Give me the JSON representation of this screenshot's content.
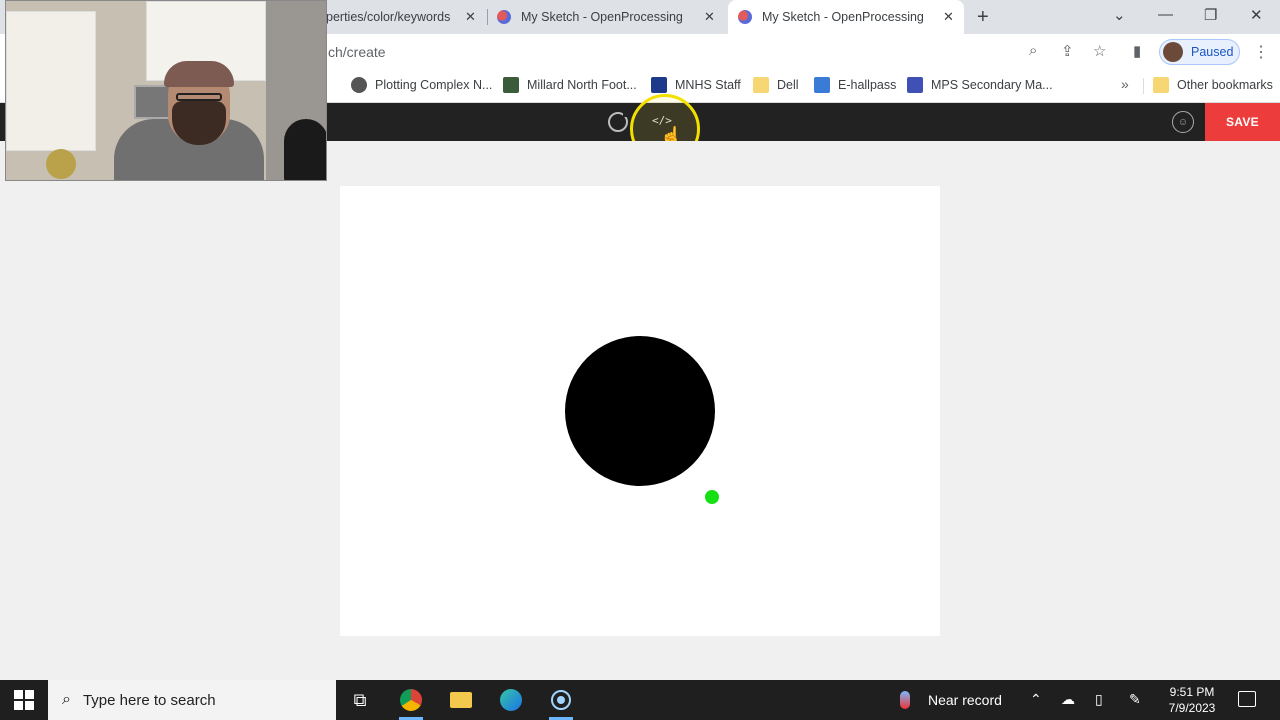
{
  "tabs": [
    {
      "title": "perties/color/keywords",
      "active": false
    },
    {
      "title": "My Sketch - OpenProcessing",
      "active": false
    },
    {
      "title": "My Sketch - OpenProcessing",
      "active": true
    }
  ],
  "address_bar": {
    "url": "ch/create",
    "profile_status": "Paused"
  },
  "bookmarks": [
    {
      "label": "Plotting Complex N...",
      "icon": "globe-icon"
    },
    {
      "label": "Millard North Foot...",
      "icon": "school-icon"
    },
    {
      "label": "MNHS Staff",
      "icon": "logo-icon"
    },
    {
      "label": "Dell",
      "icon": "folder-icon"
    },
    {
      "label": "E-hallpass",
      "icon": "pass-icon"
    },
    {
      "label": "MPS Secondary Ma...",
      "icon": "forms-icon"
    }
  ],
  "bookmarks_more": "»",
  "other_bookmarks": "Other bookmarks",
  "app_bar": {
    "code_icon": "</>",
    "save_label": "SAVE"
  },
  "canvas": {
    "background": "#ffffff",
    "shapes": [
      {
        "shape": "circle",
        "fill": "#000000"
      },
      {
        "shape": "circle",
        "fill": "#14e014"
      }
    ]
  },
  "taskbar": {
    "search_placeholder": "Type here to search",
    "weather_text": "Near record",
    "time": "9:51 PM",
    "date": "7/9/2023"
  }
}
